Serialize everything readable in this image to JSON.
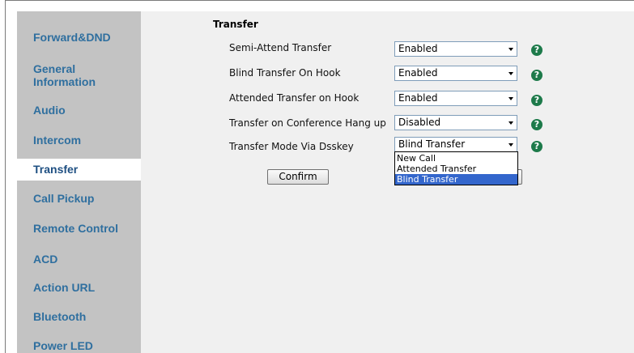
{
  "sidebar": {
    "items": [
      {
        "label": "Forward&DND",
        "id": "forward-dnd"
      },
      {
        "label": "General",
        "label2": "Information",
        "id": "general-information"
      },
      {
        "label": "Audio",
        "id": "audio"
      },
      {
        "label": "Intercom",
        "id": "intercom"
      },
      {
        "label": "Transfer",
        "id": "transfer",
        "active": true
      },
      {
        "label": "Call Pickup",
        "id": "call-pickup"
      },
      {
        "label": "Remote Control",
        "id": "remote-control"
      },
      {
        "label": "ACD",
        "id": "acd"
      },
      {
        "label": "Action URL",
        "id": "action-url"
      },
      {
        "label": "Bluetooth",
        "id": "bluetooth"
      },
      {
        "label": "Power LED",
        "id": "power-led"
      }
    ]
  },
  "section": {
    "title": "Transfer"
  },
  "settings": [
    {
      "label": "Semi-Attend Transfer",
      "value": "Enabled"
    },
    {
      "label": "Blind Transfer On Hook",
      "value": "Enabled"
    },
    {
      "label": "Attended Transfer on Hook",
      "value": "Enabled"
    },
    {
      "label": "Transfer on Conference Hang up",
      "value": "Disabled"
    },
    {
      "label": "Transfer Mode Via Dsskey",
      "value": "Blind Transfer"
    }
  ],
  "dropdown": {
    "options": [
      "New Call",
      "Attended Transfer",
      "Blind Transfer"
    ],
    "selected": "Blind Transfer"
  },
  "buttons": {
    "confirm": "Confirm"
  },
  "help": {
    "glyph": "?",
    "icon": "help-icon"
  },
  "colors": {
    "nav_text": "#2f6f9f",
    "help_icon": "#1d7a4a",
    "selected_option": "#3366cc"
  }
}
